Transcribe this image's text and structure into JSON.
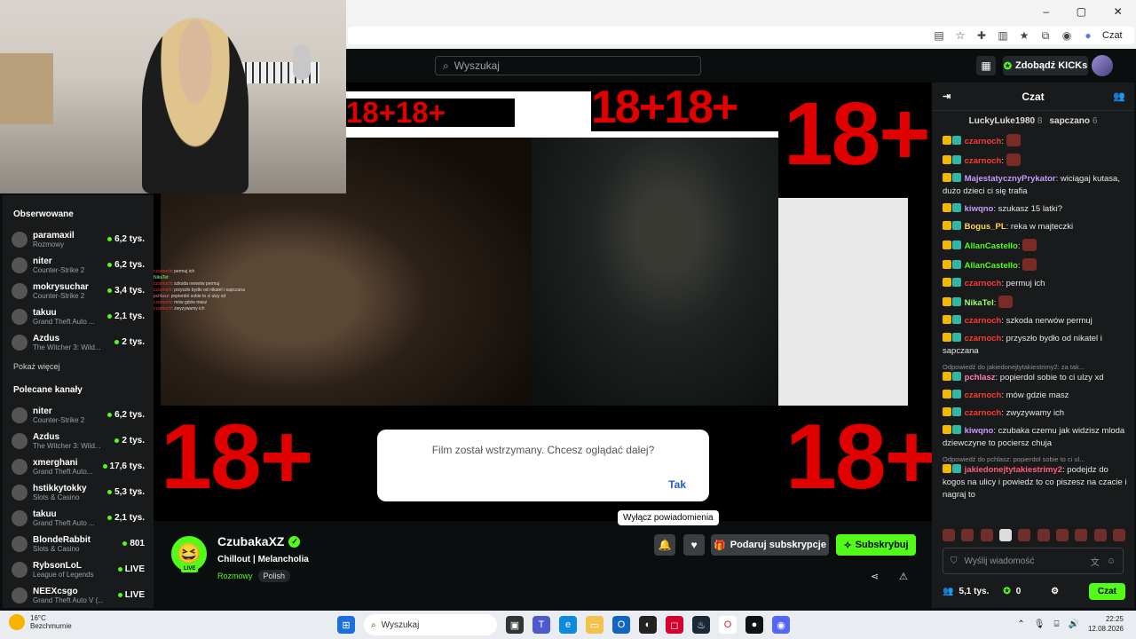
{
  "browser": {
    "controls": [
      "–",
      "▢",
      "✕"
    ],
    "czat_label": "Czat"
  },
  "header": {
    "search_placeholder": "Wyszukaj",
    "kicks_label": "Zdobądź KICKs"
  },
  "sidebar": {
    "followed_heading": "Obserwowane",
    "followed": [
      {
        "name": "paramaxil",
        "category": "Rozmowy",
        "viewers": "6,2 tys."
      },
      {
        "name": "niter",
        "category": "Counter-Strike 2",
        "viewers": "6,2 tys."
      },
      {
        "name": "mokrysuchar",
        "category": "Counter-Strike 2",
        "viewers": "3,4 tys."
      },
      {
        "name": "takuu",
        "category": "Grand Theft Auto ...",
        "viewers": "2,1 tys."
      },
      {
        "name": "Azdus",
        "category": "The Witcher 3: Wild...",
        "viewers": "2 tys."
      }
    ],
    "show_more": "Pokaż więcej",
    "recommended_heading": "Polecane kanały",
    "recommended": [
      {
        "name": "niter",
        "category": "Counter-Strike 2",
        "viewers": "6,2 tys."
      },
      {
        "name": "Azdus",
        "category": "The Witcher 3: Wild...",
        "viewers": "2 tys."
      },
      {
        "name": "xmerghani",
        "category": "Grand Theft Auto...",
        "viewers": "17,6 tys."
      },
      {
        "name": "hstikkytokky",
        "category": "Slots & Casino",
        "viewers": "5,3 tys."
      },
      {
        "name": "takuu",
        "category": "Grand Theft Auto ...",
        "viewers": "2,1 tys."
      },
      {
        "name": "BlondeRabbit",
        "category": "Slots & Casino",
        "viewers": "801"
      },
      {
        "name": "RybsonLoL",
        "category": "League of Legends",
        "viewers": "LIVE"
      },
      {
        "name": "NEEXcsgo",
        "category": "Grand Theft Auto V (...",
        "viewers": "LIVE"
      }
    ]
  },
  "player": {
    "banner_text": "18+",
    "banner_double": "18+18+",
    "dialog_text": "Film został wstrzymany. Chcesz oglądać dalej?",
    "dialog_button": "Tak",
    "overlay_chat": [
      {
        "user": "czarnoch",
        "text": "permuj ich"
      },
      {
        "user": "NikaTel",
        "text": ""
      },
      {
        "user": "czarnoch",
        "text": "szkoda nerwów permuj"
      },
      {
        "user": "czarnoch",
        "text": "przyszło bydło od nikatel i sapczana"
      },
      {
        "user": "pchlasz",
        "text": "popierdol sobie to ci ulzy xd"
      },
      {
        "user": "czarnoch",
        "text": "mów gdzie masz"
      },
      {
        "user": "czarnoch",
        "text": "zwyzywamy ich"
      }
    ]
  },
  "channel": {
    "name": "CzubakaXZ",
    "live_badge": "LIVE",
    "title": "Chillout | Melancholia",
    "category": "Rozmowy",
    "language": "Polish",
    "tooltip": "Wyłącz powiadomienia",
    "gift_label": "Podaruj subskrypcje",
    "subscribe_label": "Subskrybuj"
  },
  "chat": {
    "title": "Czat",
    "leaderboard": [
      {
        "name": "LuckyLuke1980",
        "count": "8"
      },
      {
        "name": "sapczano",
        "count": "6"
      }
    ],
    "messages": [
      {
        "user": "czarnoch",
        "color": "#ff3b30",
        "text": ""
      },
      {
        "user": "czarnoch",
        "color": "#ff3b30",
        "text": ""
      },
      {
        "user": "MajestatycznyPrykator",
        "color": "#c89bff",
        "text": "wiciągaj kutasa, dużo dzieci ci się trafia"
      },
      {
        "user": "kiwqno",
        "color": "#c89bff",
        "text": "szukasz 15 latki?"
      },
      {
        "user": "Bogus_PL",
        "color": "#ffd54a",
        "text": "reka w majteczki"
      },
      {
        "user": "AllanCastello",
        "color": "#53fc18",
        "text": ""
      },
      {
        "user": "AllanCastello",
        "color": "#53fc18",
        "text": ""
      },
      {
        "user": "czarnoch",
        "color": "#ff3b30",
        "text": "permuj ich"
      },
      {
        "user": "NikaTel",
        "color": "#9dff6e",
        "text": ""
      },
      {
        "user": "czarnoch",
        "color": "#ff3b30",
        "text": "szkoda nerwów permuj"
      },
      {
        "user": "czarnoch",
        "color": "#ff3b30",
        "text": "przyszło bydło od nikatel i sapczana"
      },
      {
        "reply": "Odpowiedź do jakiedonejtytakiestrimy2: za tak...",
        "user": "pchlasz",
        "color": "#ff7fb6",
        "text": "popierdol sobie to ci ulzy xd"
      },
      {
        "user": "czarnoch",
        "color": "#ff3b30",
        "text": "mów gdzie masz"
      },
      {
        "user": "czarnoch",
        "color": "#ff3b30",
        "text": "zwyzywamy ich"
      },
      {
        "user": "kiwqno",
        "color": "#c89bff",
        "text": "czubaka czemu jak widzisz mloda dziewczyne to pociersz chuja"
      },
      {
        "reply": "Odpowiedź do pchlasz: popierdol sobie to ci ul...",
        "user": "jakiedonejtytakiestrimy2",
        "color": "#ff5c7a",
        "text": "podejdz do kogos na ulicy i powiedz to co piszesz na czacie i nagraj to"
      }
    ],
    "input_placeholder": "Wyślij wiadomość",
    "viewers": "5,1 tys.",
    "kicks": "0",
    "send_label": "Czat"
  },
  "taskbar": {
    "temp": "16°C",
    "weather": "Bezchmurnie",
    "search_placeholder": "Wyszukaj",
    "time": "22:25",
    "date": "12.08.2026"
  }
}
